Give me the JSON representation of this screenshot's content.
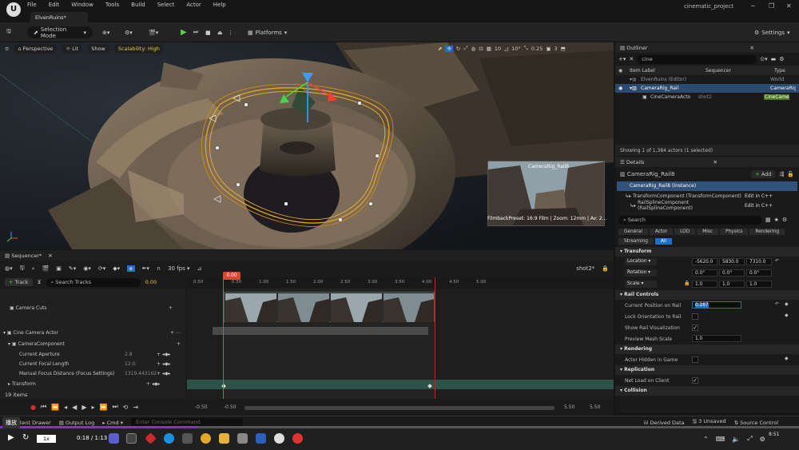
{
  "menu": [
    "File",
    "Edit",
    "Window",
    "Tools",
    "Build",
    "Select",
    "Actor",
    "Help"
  ],
  "window": {
    "tab": "ElvenRuins*",
    "project": "cinematic_project"
  },
  "toolbar": {
    "selection_mode": "Selection Mode",
    "platforms": "Platforms",
    "settings": "Settings"
  },
  "viewport": {
    "perspective": "Perspective",
    "lit": "Lit",
    "show": "Show",
    "scalability": "Scalability: High",
    "snap_angle": "10",
    "snap_rot": "10°",
    "cam_speed": "0.25",
    "grid": "3",
    "preview_label": "CameraRig_Rail8",
    "filmback": "FilmbackPreset: 16:9 Film | Zoom: 12mm | Av: 2..."
  },
  "outliner": {
    "title": "Outliner",
    "search": "cine",
    "col_label": "Item Label",
    "col_sequencer": "Sequencer",
    "col_type": "Type",
    "rows": [
      {
        "label": "ElvenRuins (Editor)",
        "seq": "",
        "type": "World"
      },
      {
        "label": "CameraRig_Rail",
        "seq": "",
        "type": "CameraRig"
      },
      {
        "label": "CineCameraActo",
        "seq": "shot2",
        "type": "CineCame"
      }
    ],
    "status": "Showing 1 of 1,384 actors (1 selected)"
  },
  "details": {
    "title": "Details",
    "actor": "CameraRig_Rail8",
    "add": "Add",
    "instance": "CameraRig_Rail8 (Instance)",
    "components": [
      {
        "name": "TransformComponent (TransformComponent)",
        "link": "Edit in C++"
      },
      {
        "name": "RailSplineComponent (RailSplineComponent)",
        "link": "Edit in C++"
      }
    ],
    "search": "Search",
    "tabs": [
      "General",
      "Actor",
      "LOD",
      "Misc",
      "Physics",
      "Rendering",
      "Streaming",
      "All"
    ],
    "transform_header": "Transform",
    "location_label": "Location",
    "location": [
      "-5620.0",
      "5830.0",
      "7310.0"
    ],
    "rotation_label": "Rotation",
    "rotation": [
      "0.0°",
      "0.0°",
      "0.0°"
    ],
    "scale_label": "Scale",
    "scale": [
      "1.0",
      "1.0",
      "1.0"
    ],
    "rail_header": "Rail Controls",
    "current_position_label": "Current Position on Rail",
    "current_position": "0.287",
    "lock_orientation_label": "Lock Orientation to Rail",
    "show_rail_label": "Show Rail Visualization",
    "preview_mesh_label": "Preview Mesh Scale",
    "preview_mesh": "1.0",
    "rendering_header": "Rendering",
    "hidden_label": "Actor Hidden in Game",
    "replication_header": "Replication",
    "net_load_label": "Net Load on Client",
    "collision_header": "Collision"
  },
  "sequencer": {
    "title": "Sequencer*",
    "fps": "30 fps",
    "shot": "shot2*",
    "track_btn": "Track",
    "search": "Search Tracks",
    "time": "0.00",
    "playhead": "0.00",
    "ruler": [
      "0.50",
      "0.50",
      "1.00",
      "1.50",
      "2.00",
      "2.50",
      "3.00",
      "3.50",
      "4.00",
      "4.50",
      "5.00"
    ],
    "tracks": {
      "cuts": "Camera Cuts",
      "actor": "Cine Camera Actor",
      "component": "CameraComponent",
      "aperture": "Current Aperture",
      "aperture_val": "2.8",
      "focal": "Current Focal Length",
      "focal_val": "12.0",
      "focus": "Manual Focus Distance (Focus Settings)",
      "focus_val": "1319.443162",
      "transform": "Transform"
    },
    "items": "19 items",
    "range": [
      "-0.50",
      "-0.50",
      "5.50",
      "5.50"
    ]
  },
  "bottombar": {
    "content_drawer": "Content Drawer",
    "output_log": "Output Log",
    "cmd": "Cmd",
    "console": "Enter Console Command",
    "derived": "Derived Data",
    "unsaved": "3 Unsaved",
    "source": "Source Control"
  },
  "player": {
    "tooltip": "播放",
    "speed": "1x",
    "time": "0:18 / 1:13"
  },
  "clock": "8:51"
}
